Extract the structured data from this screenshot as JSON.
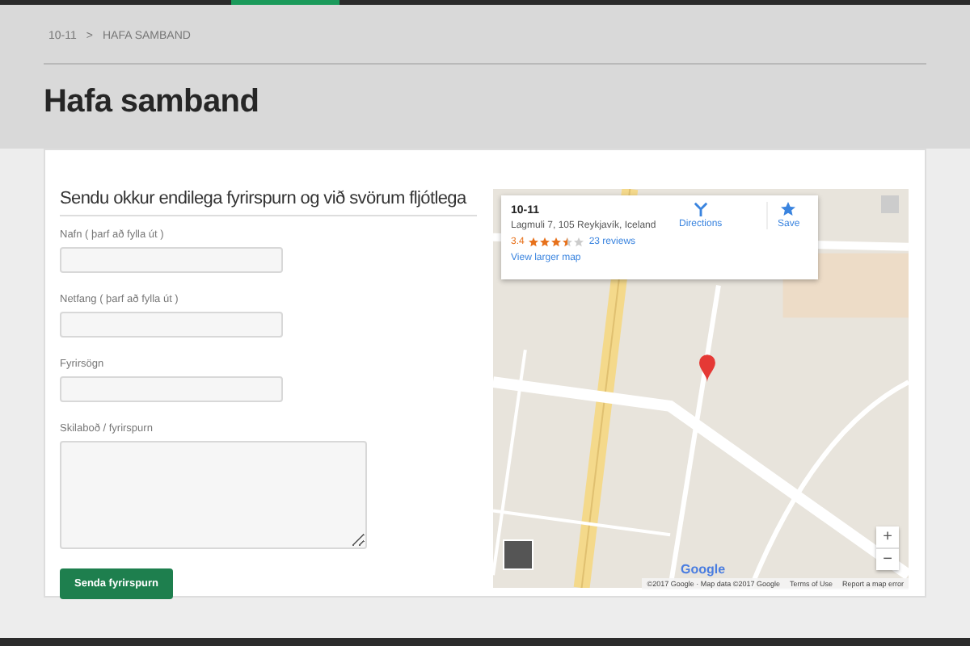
{
  "breadcrumb": {
    "items": [
      "10-11",
      "HAFA SAMBAND"
    ],
    "separator": ">"
  },
  "page_title": "Hafa samband",
  "form": {
    "heading": "Sendu okkur endilega fyrirspurn og við svörum fljótlega",
    "fields": [
      {
        "kind": "input",
        "label": "Nafn ( þarf að fylla út )"
      },
      {
        "kind": "input",
        "label": "Netfang ( þarf að fylla út )"
      },
      {
        "kind": "input",
        "label": "Fyrirsögn"
      },
      {
        "kind": "textarea",
        "label": "Skilaboð / fyrirspurn"
      }
    ],
    "submit": "Senda fyrirspurn"
  },
  "map": {
    "place_card": {
      "name": "10-11",
      "address": "Lagmuli 7, 105 Reykjavík, Iceland",
      "rating": "3.4",
      "stars": 3.5,
      "reviews": "23 reviews",
      "larger_map": "View larger map",
      "directions": "Directions",
      "save": "Save"
    },
    "zoom_in": "+",
    "zoom_out": "−",
    "logo": "Google",
    "attribution": "©2017 Google · Map data ©2017 Google",
    "terms": "Terms of Use",
    "report": "Report a map error"
  }
}
